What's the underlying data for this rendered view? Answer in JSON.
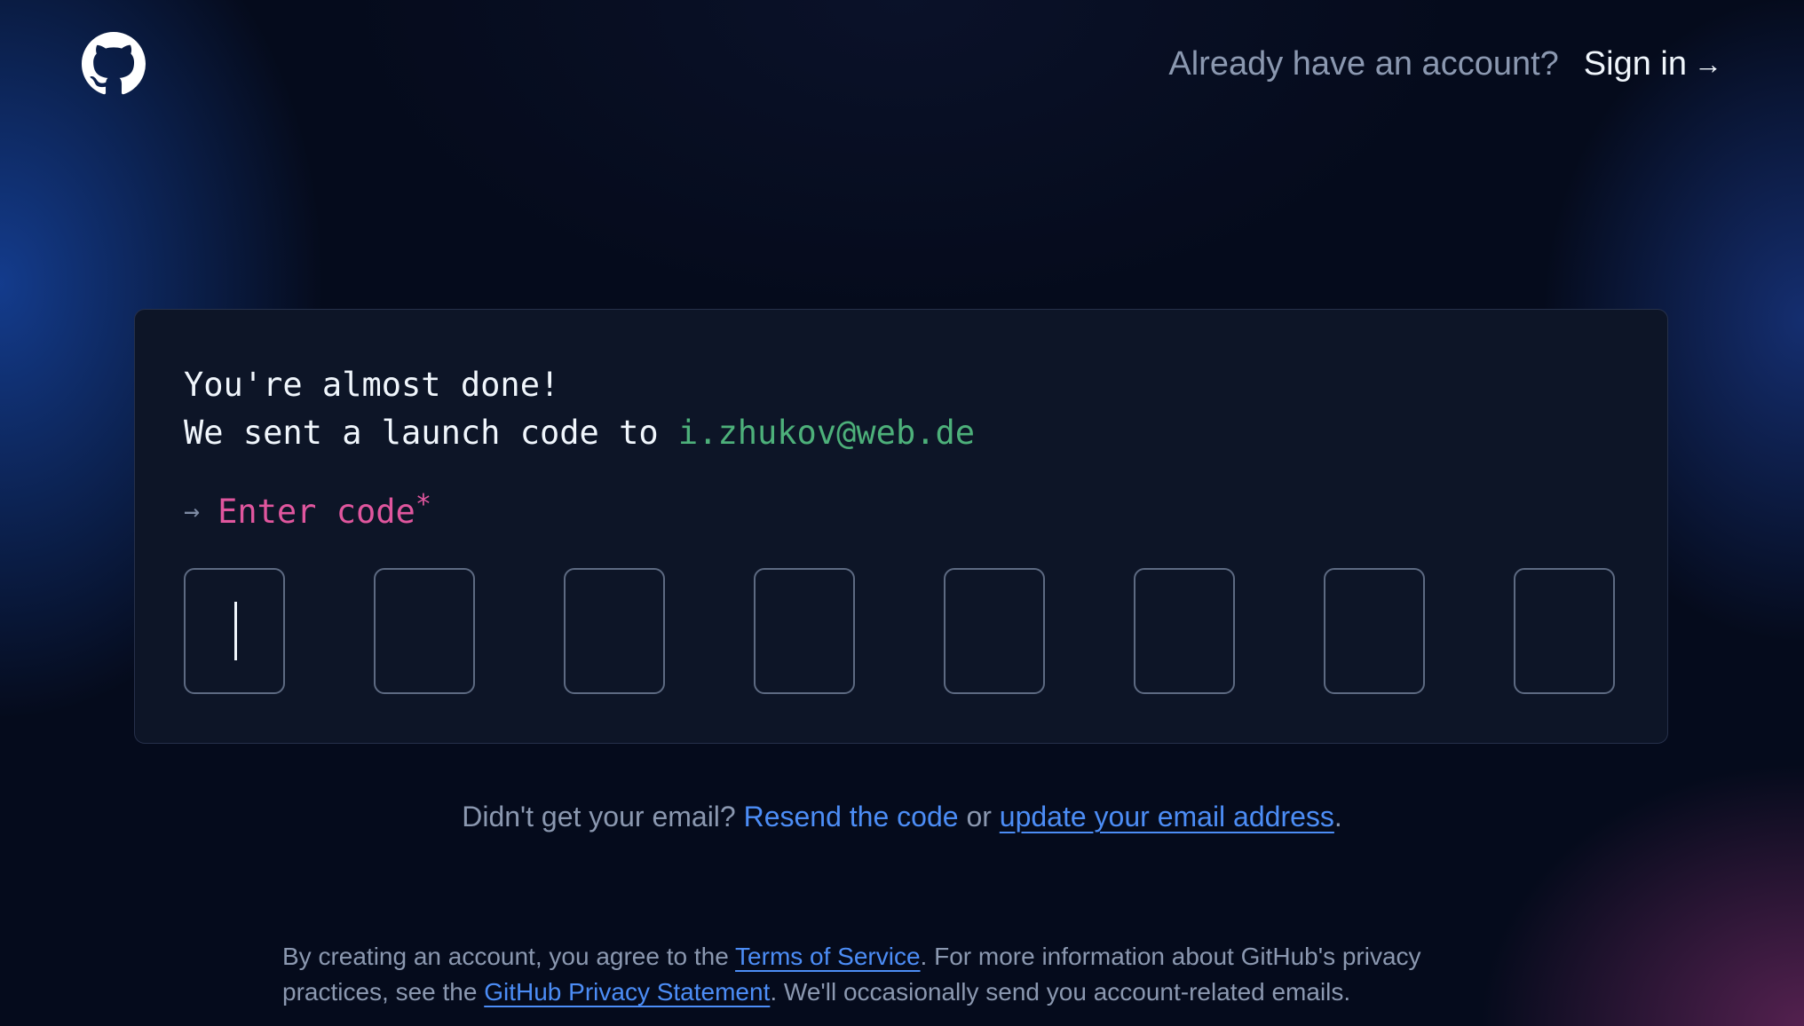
{
  "header": {
    "logo_icon": "github-octocat-icon",
    "prompt": "Already have an account?",
    "signin_label": "Sign in",
    "signin_arrow": "→"
  },
  "card": {
    "line1": "You're almost done!",
    "line2_prefix": "We sent a launch code to ",
    "email": "i.zhukov@web.de",
    "enter_arrow": "→",
    "enter_label": "Enter code",
    "required_mark": "*",
    "code_digits": [
      "",
      "",
      "",
      "",
      "",
      "",
      "",
      ""
    ]
  },
  "resend": {
    "prefix": "Didn't get your email? ",
    "resend_link": "Resend the code",
    "middle": " or ",
    "update_link": "update your email address",
    "suffix": "."
  },
  "legal": {
    "part1": "By creating an account, you agree to the ",
    "terms_link": "Terms of Service",
    "part2": ". For more information about GitHub's privacy practices, see the ",
    "privacy_link": "GitHub Privacy Statement",
    "part3": ". We'll occasionally send you account-related emails."
  },
  "colors": {
    "background": "#050b1c",
    "card": "#0d1527",
    "email_green": "#4db07a",
    "label_pink": "#e0569e",
    "link_blue": "#4c8df6",
    "muted_text": "#8b98b0"
  }
}
